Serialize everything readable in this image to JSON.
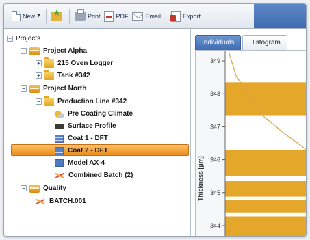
{
  "toolbar": {
    "new_label": "New",
    "print_label": "Print",
    "pdf_label": "PDF",
    "email_label": "Email",
    "export_label": "Export"
  },
  "tree": {
    "root": "Projects",
    "project_alpha": "Project Alpha",
    "oven_logger": "215 Oven Logger",
    "tank": "Tank #342",
    "project_north": "Project North",
    "production_line": "Production Line #342",
    "pre_coating": "Pre Coating Climate",
    "surface_profile": "Surface Profile",
    "coat1": "Coat 1 - DFT",
    "coat2": "Coat 2 - DFT",
    "model": "Model AX-4",
    "combined": "Combined Batch (2)",
    "quality": "Quality",
    "batch": "BATCH.001"
  },
  "tabs": [
    {
      "label": "Individuals",
      "active": true
    },
    {
      "label": "Histogram",
      "active": false
    }
  ],
  "colors": {
    "accent": "#3f6db3",
    "selection": "#ec8b1c",
    "histogram_bar": "#e4a72a",
    "trend_line": "#d8a442"
  },
  "chart_data": {
    "type": "bar",
    "ylabel": "Thickness [µm]",
    "yticks": [
      349,
      348,
      347,
      346,
      345,
      344
    ],
    "bands": [
      {
        "from": 343.55,
        "to": 344.28
      },
      {
        "from": 344.4,
        "to": 344.78
      },
      {
        "from": 344.88,
        "to": 345.36
      },
      {
        "from": 345.5,
        "to": 346.3
      },
      {
        "from": 347.35,
        "to": 348.35
      }
    ],
    "curve": [
      {
        "y": 349.25,
        "v": 0.03
      },
      {
        "y": 348.55,
        "v": 0.12
      },
      {
        "y": 348.0,
        "v": 0.27
      },
      {
        "y": 347.3,
        "v": 0.47
      },
      {
        "y": 346.8,
        "v": 0.72
      },
      {
        "y": 346.3,
        "v": 1.0
      }
    ]
  }
}
